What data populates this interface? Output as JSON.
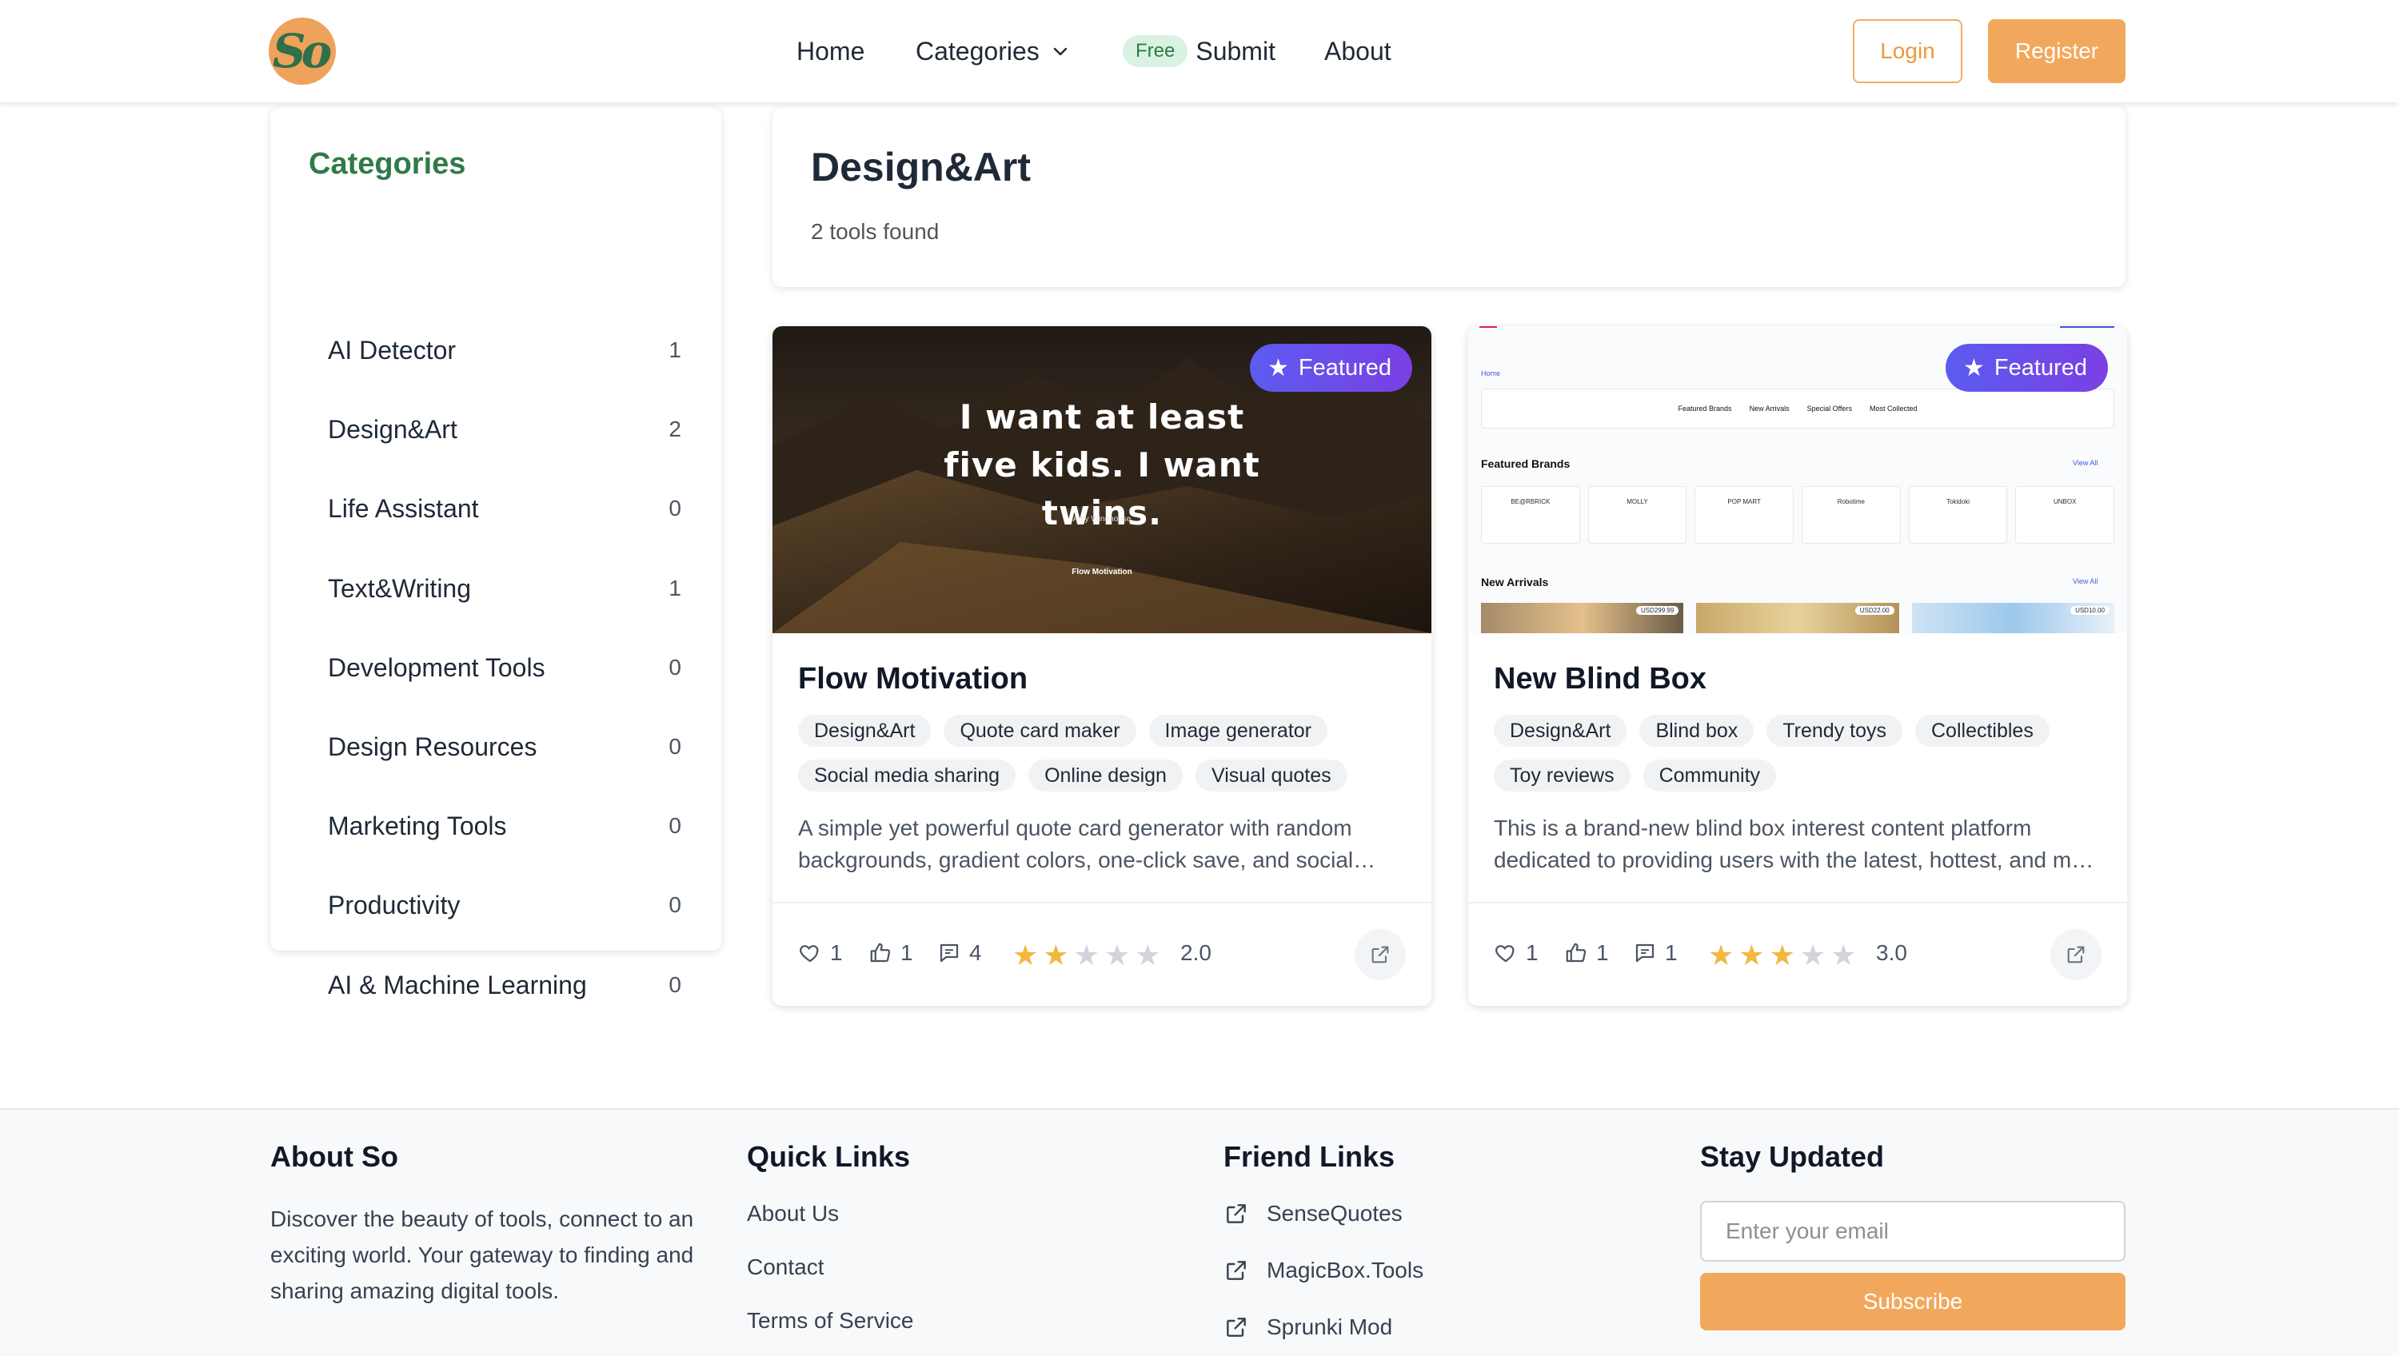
{
  "header": {
    "logo_text": "So",
    "nav": {
      "home": "Home",
      "categories": "Categories",
      "free_badge": "Free",
      "submit": "Submit",
      "about": "About"
    },
    "login": "Login",
    "register": "Register"
  },
  "sidebar": {
    "title": "Categories",
    "items": [
      {
        "label": "AI Detector",
        "count": "1"
      },
      {
        "label": "Design&Art",
        "count": "2"
      },
      {
        "label": "Life Assistant",
        "count": "0"
      },
      {
        "label": "Text&Writing",
        "count": "1"
      },
      {
        "label": "Development Tools",
        "count": "0"
      },
      {
        "label": "Design Resources",
        "count": "0"
      },
      {
        "label": "Marketing Tools",
        "count": "0"
      },
      {
        "label": "Productivity",
        "count": "0"
      },
      {
        "label": "AI & Machine Learning",
        "count": "0"
      }
    ]
  },
  "main": {
    "title": "Design&Art",
    "subtitle": "2 tools found",
    "cards": [
      {
        "featured": "Featured",
        "name": "Flow Motivation",
        "thumb_quote": "I want at least five kids. I want twins.",
        "thumb_author": "Amy Winehouse",
        "thumb_brand": "Flow Motivation",
        "tags": [
          "Design&Art",
          "Quote card maker",
          "Image generator",
          "Social media sharing",
          "Online design",
          "Visual quotes"
        ],
        "description": "A simple yet powerful quote card generator with random backgrounds, gradient colors, one-click save, and social sharing features.",
        "likes": "1",
        "thumbs": "1",
        "comments": "4",
        "rating": 2,
        "rating_text": "2.0"
      },
      {
        "featured": "Featured",
        "name": "New Blind Box",
        "thumb": {
          "home": "Home",
          "tabs": [
            "Featured Brands",
            "New Arrivals",
            "Special Offers",
            "Most Collected"
          ],
          "featured_brands": "Featured Brands",
          "view_all": "View All",
          "brands": [
            "BE@RBRICK",
            "MOLLY",
            "POP MART",
            "Robotime",
            "Tokidoki",
            "UNBOX"
          ],
          "new_arrivals": "New Arrivals",
          "prices": [
            "USD299.99",
            "USD22.00",
            "USD10.00"
          ]
        },
        "tags": [
          "Design&Art",
          "Blind box",
          "Trendy toys",
          "Collectibles",
          "Toy reviews",
          "Community"
        ],
        "description": "This is a brand-new blind box interest content platform dedicated to providing users with the latest, hottest, and most interesting blind box information.",
        "likes": "1",
        "thumbs": "1",
        "comments": "1",
        "rating": 3,
        "rating_text": "3.0"
      }
    ]
  },
  "footer": {
    "about_title": "About So",
    "about_text": "Discover the beauty of tools, connect to an exciting world. Your gateway to finding and sharing amazing digital tools.",
    "quick_title": "Quick Links",
    "quick_links": [
      "About Us",
      "Contact",
      "Terms of Service"
    ],
    "friend_title": "Friend Links",
    "friend_links": [
      "SenseQuotes",
      "MagicBox.Tools",
      "Sprunki Mod"
    ],
    "stay_title": "Stay Updated",
    "email_placeholder": "Enter your email",
    "subscribe": "Subscribe"
  },
  "colors": {
    "accent": "#f2a85c",
    "green": "#2f7a48",
    "featured": "#5b5cf0",
    "star": "#f4b73f"
  }
}
